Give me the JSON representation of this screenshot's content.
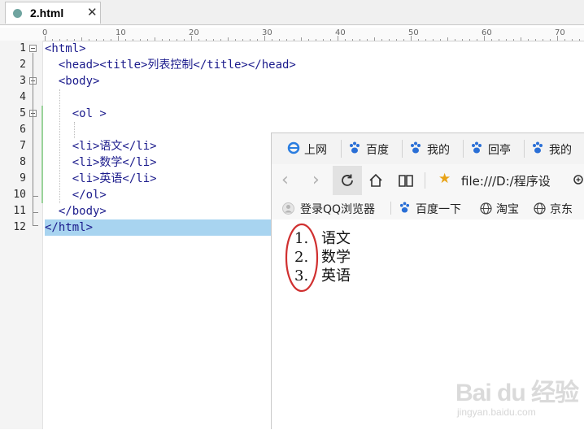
{
  "editor": {
    "tab_title": "2.html",
    "tab_close": "✕",
    "ruler_labels": [
      "0",
      "10",
      "20",
      "30",
      "40",
      "50",
      "60",
      "70"
    ],
    "line_numbers": [
      "1",
      "2",
      "3",
      "4",
      "5",
      "6",
      "7",
      "8",
      "9",
      "10",
      "11",
      "12"
    ],
    "code_lines": [
      "<html>",
      "  <head><title>列表控制</title></head>",
      "  <body>",
      "",
      "    <ol >",
      "",
      "    <li>语文</li>",
      "    <li>数学</li>",
      "    <li>英语</li>",
      "    </ol>",
      "  </body>",
      "</html>"
    ],
    "selected_line": 12
  },
  "browser": {
    "bookmarks_top": [
      "上网",
      "百度",
      "我的",
      "回亭",
      "我的"
    ],
    "address": "file:///D:/程序设",
    "bookmarks_bar": [
      "登录QQ浏览器",
      "百度一下",
      "淘宝",
      "京东"
    ],
    "list": [
      {
        "num": "1.",
        "text": "语文"
      },
      {
        "num": "2.",
        "text": "数学"
      },
      {
        "num": "3.",
        "text": "英语"
      }
    ]
  },
  "watermark": {
    "brand": "Bai du 经验",
    "url": "jingyan.baidu.com"
  },
  "colors": {
    "tag_color": "#1b1b8c",
    "selection": "#a8d4f0",
    "annotation_circle": "#d03030",
    "star": "#e8a317",
    "paw": "#2a6fd6"
  }
}
